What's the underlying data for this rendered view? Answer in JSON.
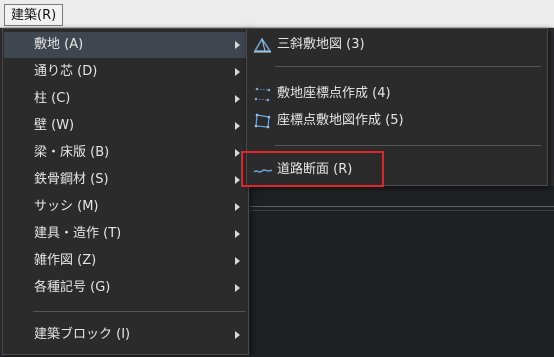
{
  "menubar": {
    "item_label": "建築(R)"
  },
  "main_menu": {
    "items": [
      {
        "label": "敷地 (A)",
        "has_submenu": true
      },
      {
        "label": "通り芯 (D)",
        "has_submenu": true
      },
      {
        "label": "柱 (C)",
        "has_submenu": true
      },
      {
        "label": "壁 (W)",
        "has_submenu": true
      },
      {
        "label": "梁・床版 (B)",
        "has_submenu": true
      },
      {
        "label": "鉄骨鋼材 (S)",
        "has_submenu": true
      },
      {
        "label": "サッシ (M)",
        "has_submenu": true
      },
      {
        "label": "建具・造作 (T)",
        "has_submenu": true
      },
      {
        "label": "雑作図 (Z)",
        "has_submenu": true
      },
      {
        "label": "各種記号 (G)",
        "has_submenu": true
      },
      {
        "label": "建築ブロック (I)",
        "has_submenu": true
      }
    ]
  },
  "sub_menu": {
    "items": [
      {
        "label": "三斜敷地図 (3)",
        "icon": "triangle-site-icon"
      },
      {
        "label": "敷地座標点作成 (4)",
        "icon": "coordinate-points-icon"
      },
      {
        "label": "座標点敷地図作成 (5)",
        "icon": "coordinate-site-map-icon"
      },
      {
        "label": "道路断面 (R)",
        "icon": "road-section-icon"
      }
    ]
  },
  "colors": {
    "menu_bg": "#2b2b2b",
    "highlight": "#3f4650",
    "focus_border": "#e0262b",
    "icon_blue": "#6fa8dc"
  }
}
